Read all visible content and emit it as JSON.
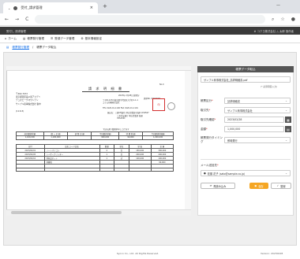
{
  "browser": {
    "tab_title": "受付_請求管理",
    "close_glyph": "×",
    "new_tab_glyph": "+",
    "back": "←",
    "forward": "→",
    "reload": "C",
    "window_controls": "—"
  },
  "app": {
    "header_left": "受付し   請求管理",
    "header_right": "# コクヨ株式会社   △ 太郎   操作者",
    "menu": [
      {
        "icon": "home-icon",
        "label": "ホーム"
      },
      {
        "icon": "doc-icon",
        "label": "帳票発行管理"
      },
      {
        "icon": "list-icon",
        "label": "受領データ管理"
      },
      {
        "icon": "gear-icon",
        "label": "基本情報設定"
      }
    ],
    "breadcrumb": {
      "link": "帳票発行管理",
      "sep": "/",
      "current": "帳票データ取込"
    }
  },
  "document": {
    "title": "請 求 明 細 書",
    "top_right_id": "No.0",
    "date_line": "2023年 2月28日 締切分",
    "number_line": "請求No. 00000001",
    "zip": "〒462-7072",
    "address1": "東京都港区品川東アカデミ",
    "address2": "デュオピークマウンテン",
    "recipient": "サンプル商事株式会社 御中",
    "code": "(11113)",
    "issuer1": "〒104-1234 東京都千代田区大手町1-1-1",
    "issuer2": "コクヨ印刷株式会社",
    "issuer3": "TEL 0120-01-1100  FAX 0120-01-1101",
    "bank1": "振込先：三菱UFJ銀行 本店営業部 普通 1234567",
    "bank2": "三井住友銀行 本店営業部 普通 7654321",
    "note": "下記の通り御請求申し上げます",
    "summary_headers": [
      "前回御請求額",
      "御 入 金 額",
      "調 整 金 額",
      "今回御請求額",
      "消 費 税 額",
      "今回御請求総額"
    ],
    "summary_values": [
      "1,100,000",
      "1,100,000",
      "",
      "900,000",
      "90,000",
      "1,000,000"
    ],
    "detail_headers": [
      "日付",
      "品名コード/品名",
      "数量",
      "単位",
      "単 価",
      "金 額"
    ],
    "detail_rows": [
      [
        "2023/02/01",
        "ノートパソコン",
        "2",
        "台",
        "150,000",
        "300,000"
      ],
      [
        "2023/02/05",
        "レーザープリンター",
        "1",
        "台",
        "200,000",
        "200,000"
      ],
      [
        "2023/02/10",
        "消耗品セット",
        "1",
        "式",
        "100,000",
        "100,000"
      ],
      [
        "",
        "消費税",
        "",
        "",
        "",
        "90,000"
      ]
    ]
  },
  "panel": {
    "title": "帳票データ取込",
    "file_name": "サンプル商事株式会社_請求明細書.pdf",
    "required_note": "(* 必須項目入力)",
    "fields": [
      {
        "label": "帳票区分",
        "value": "請求明細書"
      },
      {
        "label": "取引先",
        "value": "サンプル商事株式会社"
      },
      {
        "label": "取引先確認",
        "value": "2023/02/28"
      },
      {
        "label": "金額",
        "value": "1,000,000"
      },
      {
        "label": "帳票発行タイミング",
        "value": "即時発行"
      }
    ],
    "mail_label": "メール送信先",
    "mail_value": "佐藤 花子 (sato@sample.co.jp)",
    "btn_preview": "再読み込み",
    "btn_save": "保存",
    "btn_register": "登録"
  },
  "footer": {
    "copyright": "Kyoco Co., Ltd. All Rights Reserved.",
    "version": "Version: 20230228"
  }
}
